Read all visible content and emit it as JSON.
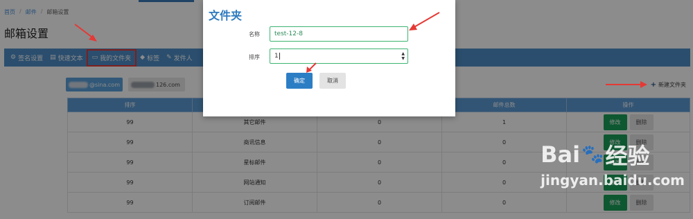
{
  "breadcrumb": {
    "home": "首页",
    "mail": "邮件",
    "current": "邮箱设置"
  },
  "page": {
    "title": "邮箱设置"
  },
  "tabs": [
    {
      "icon": "⚙",
      "label": "签名设置"
    },
    {
      "icon": "▤",
      "label": "快速文本"
    },
    {
      "icon": "▭",
      "label": "我的文件夹"
    },
    {
      "icon": "◆",
      "label": "标签"
    },
    {
      "icon": "✎",
      "label": "发件人"
    }
  ],
  "accounts": {
    "first": "@sina.com",
    "second": "126.com"
  },
  "new_folder_label": "新建文件夹",
  "table": {
    "headers": [
      "排序",
      "",
      "",
      "邮件总数",
      "操作"
    ],
    "edit_label": "修改",
    "delete_label": "删除",
    "rows": [
      {
        "order": "99",
        "name": "其它邮件",
        "unread": "0",
        "total": "1"
      },
      {
        "order": "99",
        "name": "商讯信息",
        "unread": "0",
        "total": "0"
      },
      {
        "order": "99",
        "name": "星标邮件",
        "unread": "0",
        "total": "0"
      },
      {
        "order": "99",
        "name": "网站通知",
        "unread": "0",
        "total": "0"
      },
      {
        "order": "99",
        "name": "订阅邮件",
        "unread": "0",
        "total": "0"
      }
    ]
  },
  "dialog": {
    "title": "文件夹",
    "name_label": "名称",
    "name_value": "test-12-8",
    "order_label": "排序",
    "order_value": "1",
    "ok_label": "确定",
    "cancel_label": "取消"
  },
  "colors": {
    "accent": "#4f8fc9",
    "annotation": "#e53935",
    "confirm": "#2c7ec4",
    "edit": "#1aa05a"
  },
  "watermark": {
    "brand": "Bai",
    "brand2": "经验",
    "url": "jingyan.baidu.com"
  }
}
